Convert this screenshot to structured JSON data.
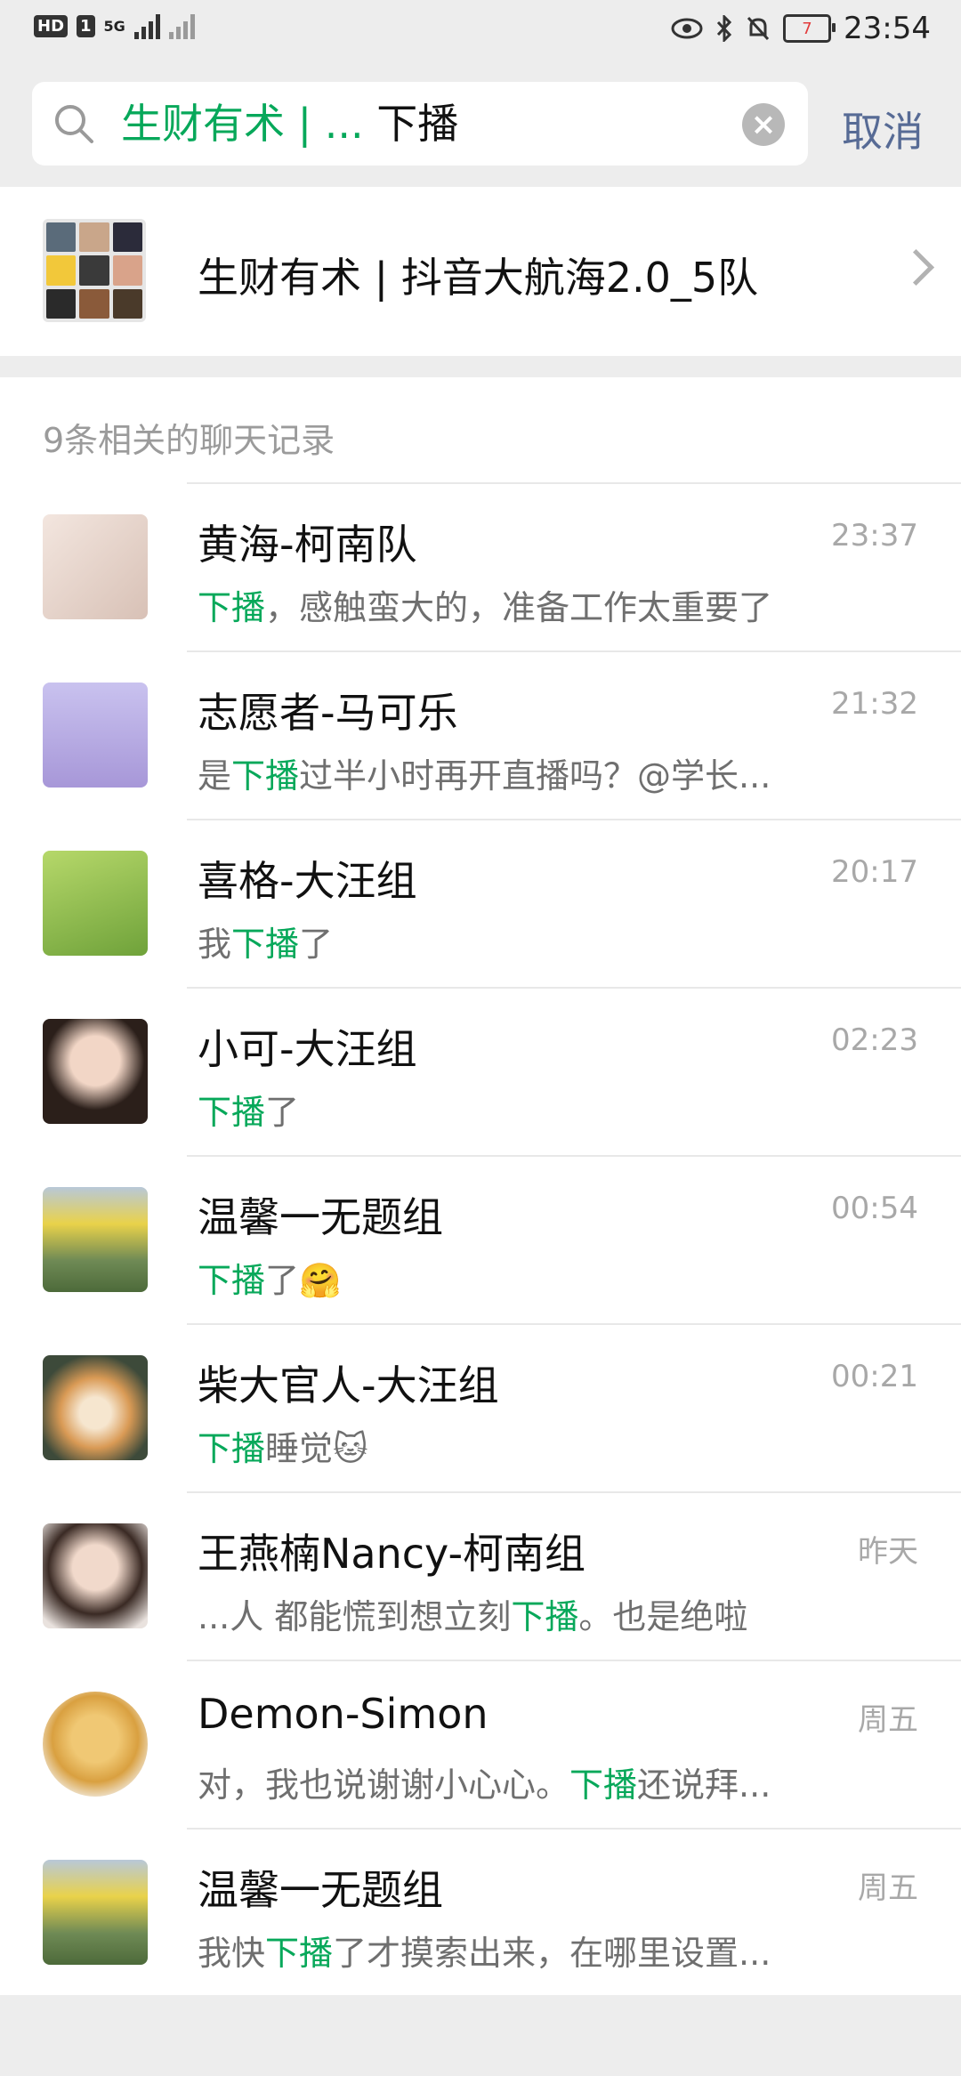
{
  "status_bar": {
    "network_badge": "HD",
    "sim_label": "1",
    "network_type": "5G",
    "time": "23:54",
    "battery_level": "7"
  },
  "search": {
    "query_prefix": "生财有术 | ...",
    "query_keyword": "下播",
    "cancel_label": "取消"
  },
  "group": {
    "name": "生财有术 | 抖音大航海2.0_5队"
  },
  "results": {
    "header": "9条相关的聊天记录",
    "items": [
      {
        "name": "黄海-柯南队",
        "time": "23:37",
        "pre": "",
        "kw": "下播",
        "post": "，感触蛮大的，准备工作太重要了"
      },
      {
        "name": "志愿者-马可乐",
        "time": "21:32",
        "pre": "是",
        "kw": "下播",
        "post": "过半小时再开直播吗？@学长..."
      },
      {
        "name": "喜格-大汪组",
        "time": "20:17",
        "pre": "我",
        "kw": "下播",
        "post": "了"
      },
      {
        "name": "小可-大汪组",
        "time": "02:23",
        "pre": "",
        "kw": "下播",
        "post": "了"
      },
      {
        "name": "温馨一无题组",
        "time": "00:54",
        "pre": "",
        "kw": "下播",
        "post": "了🤗"
      },
      {
        "name": "柴大官人-大汪组",
        "time": "00:21",
        "pre": "",
        "kw": "下播",
        "post": "睡觉🐱"
      },
      {
        "name": "王燕楠Nancy-柯南组",
        "time": "昨天",
        "pre": "...人 都能慌到想立刻",
        "kw": "下播",
        "post": "。也是绝啦"
      },
      {
        "name": "Demon-Simon",
        "time": "周五",
        "pre": "对，我也说谢谢小心心。",
        "kw": "下播",
        "post": "还说拜..."
      },
      {
        "name": "温馨一无题组",
        "time": "周五",
        "pre": "我快",
        "kw": "下播",
        "post": "了才摸索出来，在哪里设置..."
      }
    ]
  },
  "colors": {
    "highlight": "#07a85a",
    "cancel": "#576b95",
    "background": "#ededed"
  }
}
